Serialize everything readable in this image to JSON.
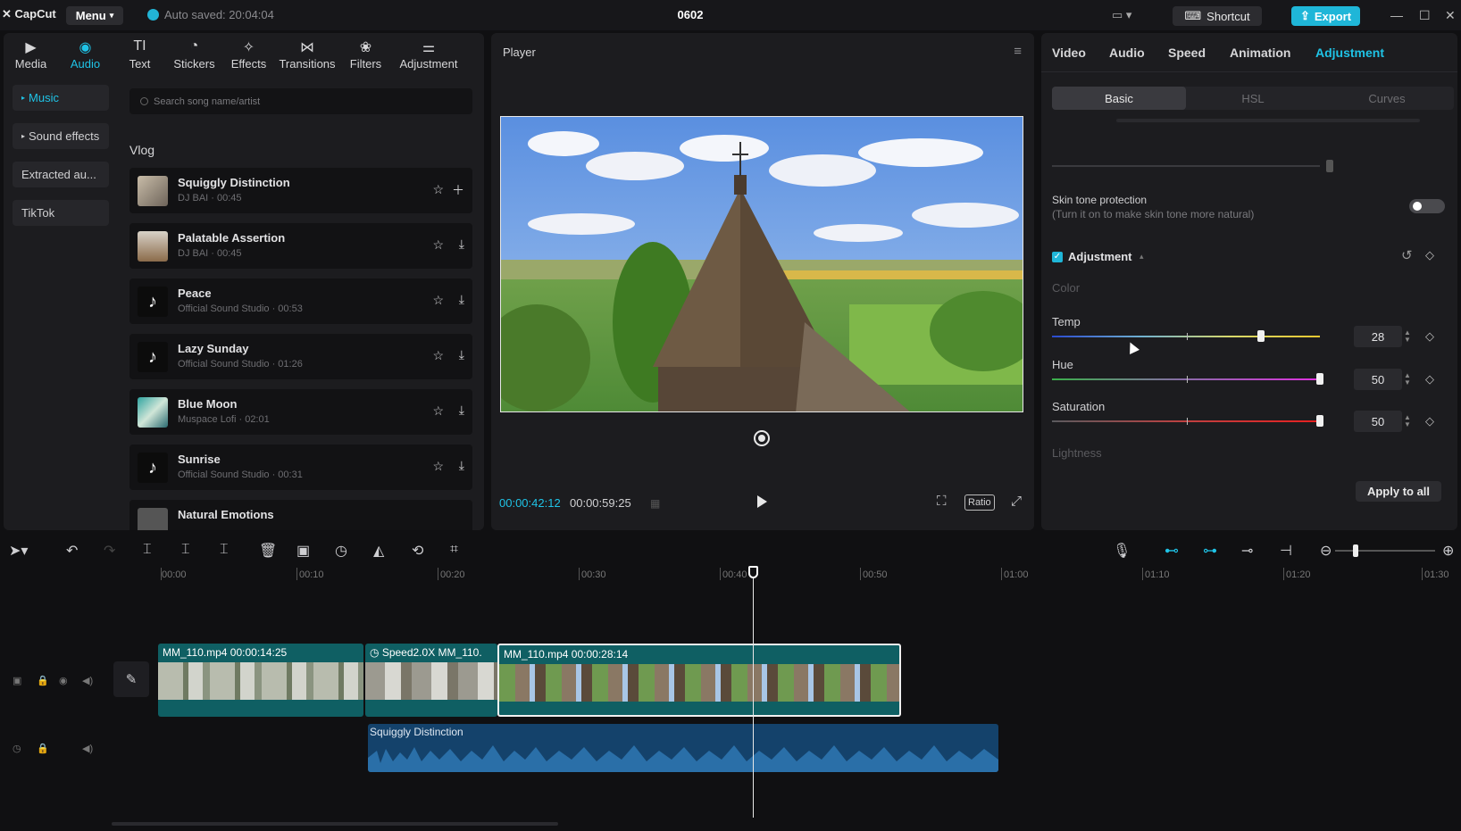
{
  "titlebar": {
    "app_name": "CapCut",
    "menu_label": "Menu",
    "autosave": "Auto saved: 20:04:04",
    "project_title": "0602",
    "shortcut_label": "Shortcut",
    "export_label": "Export"
  },
  "left_tools": [
    {
      "label": "Media",
      "icon": "media-icon"
    },
    {
      "label": "Audio",
      "icon": "audio-icon"
    },
    {
      "label": "Text",
      "icon": "text-icon"
    },
    {
      "label": "Stickers",
      "icon": "stickers-icon"
    },
    {
      "label": "Effects",
      "icon": "effects-icon"
    },
    {
      "label": "Transitions",
      "icon": "transitions-icon"
    },
    {
      "label": "Filters",
      "icon": "filters-icon"
    },
    {
      "label": "Adjustment",
      "icon": "adjustment-icon"
    }
  ],
  "audio_sidebar": [
    {
      "label": "Music"
    },
    {
      "label": "Sound effects"
    },
    {
      "label": "Extracted au..."
    },
    {
      "label": "TikTok"
    }
  ],
  "search": {
    "placeholder": "Search song name/artist"
  },
  "category": "Vlog",
  "songs": [
    {
      "name": "Squiggly Distinction",
      "meta": "DJ BAI · 00:45"
    },
    {
      "name": "Palatable Assertion",
      "meta": "DJ BAI · 00:45"
    },
    {
      "name": "Peace",
      "meta": "Official Sound Studio · 00:53"
    },
    {
      "name": "Lazy Sunday",
      "meta": "Official Sound Studio · 01:26"
    },
    {
      "name": "Blue Moon",
      "meta": "Muspace Lofi · 02:01"
    },
    {
      "name": "Sunrise",
      "meta": "Official Sound Studio · 00:31"
    },
    {
      "name": "Natural Emotions",
      "meta": ""
    }
  ],
  "player": {
    "title": "Player",
    "current_time": "00:00:42:12",
    "duration": "00:00:59:25",
    "ratio_label": "Ratio"
  },
  "right_tabs": [
    {
      "label": "Video"
    },
    {
      "label": "Audio"
    },
    {
      "label": "Speed"
    },
    {
      "label": "Animation"
    },
    {
      "label": "Adjustment"
    }
  ],
  "segments": [
    {
      "label": "Basic"
    },
    {
      "label": "HSL"
    },
    {
      "label": "Curves"
    }
  ],
  "skin_tone": {
    "title": "Skin tone protection",
    "subtitle": "(Turn it on to make skin tone more natural)"
  },
  "adjustment": {
    "title": "Adjustment",
    "color_label": "Color",
    "lightness_label": "Lightness",
    "sliders": [
      {
        "label": "Temp",
        "value": "28",
        "level": 0.78
      },
      {
        "label": "Hue",
        "value": "50",
        "level": 1.0
      },
      {
        "label": "Saturation",
        "value": "50",
        "level": 1.0
      }
    ],
    "apply_all_label": "Apply to all"
  },
  "ruler_labels": [
    "00:00",
    "00:10",
    "00:20",
    "00:30",
    "00:40",
    "00:50",
    "01:00",
    "01:10",
    "01:20",
    "01:30"
  ],
  "timeline": {
    "clips": [
      {
        "label": "MM_110.mp4   00:00:14:25"
      },
      {
        "label": "Speed2.0X   MM_110."
      },
      {
        "label": "MM_110.mp4   00:00:28:14"
      }
    ],
    "audio_clip": "Squiggly Distinction"
  },
  "colors": {
    "accent": "#1fc3e6",
    "export": "#1fb6d8",
    "clip": "#0f5f63",
    "audio_clip": "#14426b"
  }
}
